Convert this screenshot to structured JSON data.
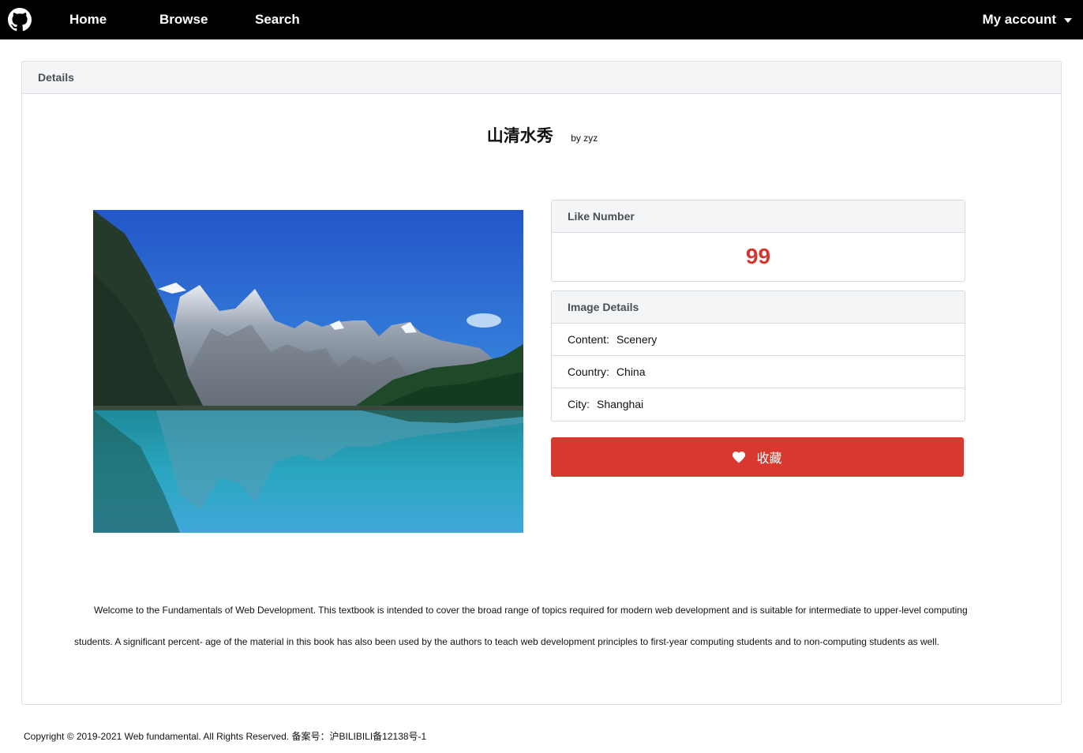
{
  "nav": {
    "logo_icon": "github-icon",
    "home": "Home",
    "browse": "Browse",
    "search": "Search",
    "account": "My account"
  },
  "card": {
    "header": "Details",
    "title": "山清水秀",
    "author": "by zyz",
    "image_alt": "lake and mountain scenery"
  },
  "like": {
    "header": "Like Number",
    "value": "99"
  },
  "image_details": {
    "header": "Image Details",
    "rows": [
      {
        "label": "Content:",
        "value": "Scenery"
      },
      {
        "label": "Country:",
        "value": "China"
      },
      {
        "label": "City:",
        "value": "Shanghai"
      }
    ]
  },
  "favorite": {
    "icon": "heart-icon",
    "label": "收藏"
  },
  "description": "Welcome to the Fundamentals of Web Development. This textbook is intended to cover the broad range of topics required for modern web development and is suitable for intermediate to upper-level computing students. A significant percent- age of the material in this book has also been used by the authors to teach web development principles to first-year computing students and to non-computing students as well.",
  "footer": "Copyright © 2019-2021 Web fundamental. All Rights Reserved. 备案号：沪BILIBILI备12138号-1",
  "colors": {
    "navbar": "#000000",
    "like_value": "#d0392f",
    "favorite_button": "#d7392e",
    "panel_header_bg": "#f4f5f7"
  }
}
